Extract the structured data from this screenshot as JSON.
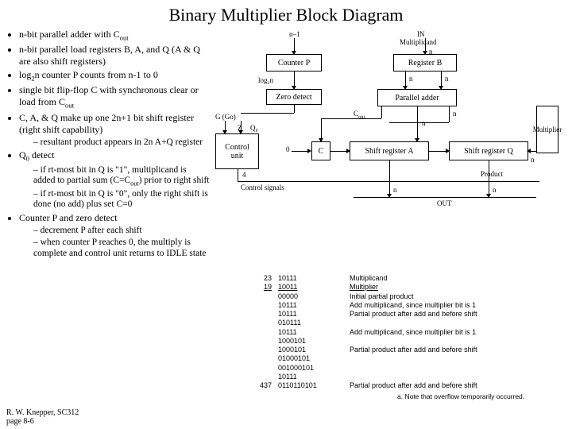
{
  "title": "Binary Multiplier Block Diagram",
  "bullets": {
    "b1": "n-bit parallel adder with C",
    "b1sub": "out",
    "b2": "n-bit parallel load registers B, A, and Q (A & Q are also shift registers)",
    "b3a": "log",
    "b3sub": "2",
    "b3b": "n counter P counts from n-1 to 0",
    "b4a": "single bit flip-flop C with synchronous clear or load from C",
    "b4sub": "out",
    "b5": "C, A, & Q make up one 2n+1 bit shift register (right shift capability)",
    "b5d1": "resultant product appears in 2n A+Q register",
    "b6": "Q",
    "b6sub": "0",
    "b6b": " detect",
    "b6d1": "if rt-most bit in Q is \"1\", multiplicand is added to partial sum (C=C",
    "b6d1sub": "out",
    "b6d1b": ") prior to right shift",
    "b6d2": "if rt-most bit in Q is \"0\", only the right shift is done (no add) plus set C=0",
    "b7": "Counter P and zero detect",
    "b7d1": "decrement P after each shift",
    "b7d2": "when counter P reaches 0, the multiply is complete and control unit returns to IDLE state"
  },
  "footer": {
    "l1": "R. W. Knepper, SC312",
    "l2": "page 8-6"
  },
  "diag": {
    "nminus1": "n–1",
    "in": "IN",
    "multiplicand": "Multiplicand",
    "counterP": "Counter P",
    "registerB": "Register B",
    "log2n": "log₂n",
    "zerodetect": "Zero detect",
    "paralleladder": "Parallel adder",
    "cout": "C",
    "coutsub": "out",
    "g": "G (Go)",
    "n": "n",
    "z": "Z",
    "q0": "Q₀",
    "controlunit": "Control unit",
    "zero": "0",
    "c": "C",
    "shiftA": "Shift register A",
    "shiftQ": "Shift register Q",
    "multiplier": "Multiplier",
    "four": "4",
    "ctrlsig": "Control signals",
    "product": "Product",
    "out": "OUT"
  },
  "trace": [
    {
      "c1": "23",
      "c2": "10111",
      "c3": "Multiplicand"
    },
    {
      "c1": "19",
      "c2": "10011",
      "c3": "Multiplier"
    },
    {
      "c1": "",
      "c2": "00000",
      "c3": "Initial partial product"
    },
    {
      "c1": "",
      "c2": "10111",
      "c3": "Add multiplicand, since multiplier bit is 1"
    },
    {
      "c1": "",
      "c2": "10111",
      "c3": "Partial product after add and before shift"
    },
    {
      "c1": "",
      "c2": "010111",
      "c3": ""
    },
    {
      "c1": "",
      "c2": "10111",
      "c3": "Add multiplicand, since multiplier bit is 1"
    },
    {
      "c1": "",
      "c2": "1000101",
      "c3": ""
    },
    {
      "c1": "",
      "c2": "1000101",
      "c3": "Partial product after add and before shift"
    },
    {
      "c1": "",
      "c2": "01000101",
      "c3": ""
    },
    {
      "c1": "",
      "c2": "001000101",
      "c3": ""
    },
    {
      "c1": "",
      "c2": "10111",
      "c3": ""
    },
    {
      "c1": "437",
      "c2": "0110110101",
      "c3": "Partial product after add and before shift"
    }
  ],
  "trace_note": "a. Note that overflow temporarily occurred."
}
